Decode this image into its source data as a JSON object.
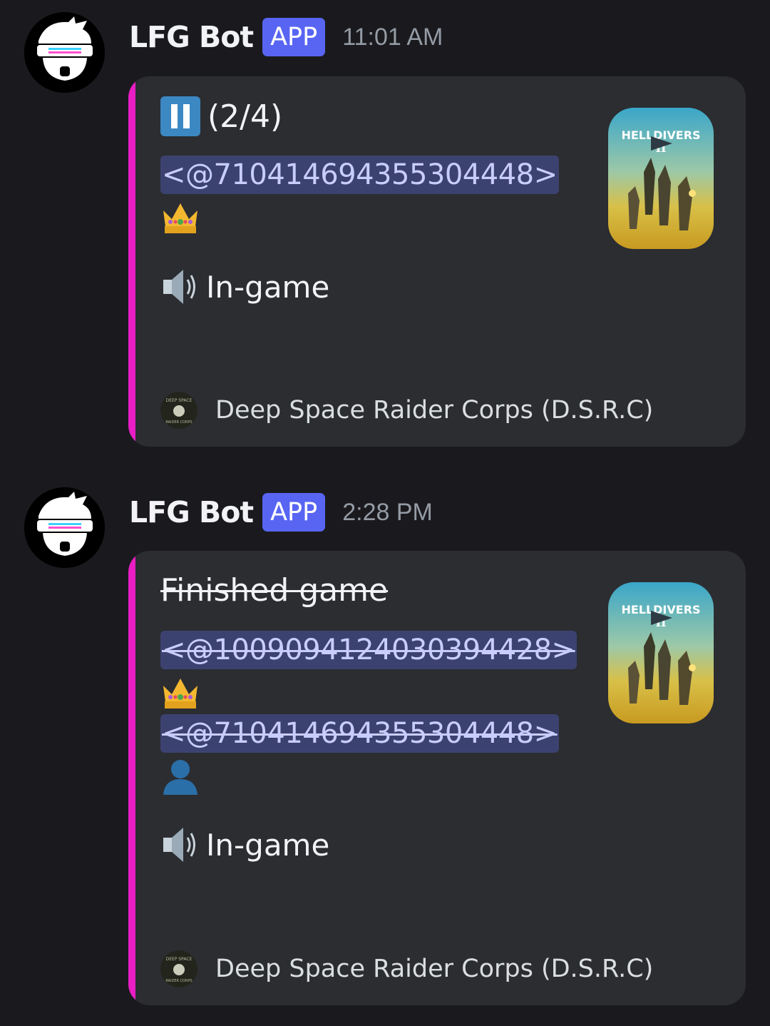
{
  "messages": [
    {
      "username": "LFG Bot",
      "badge": "APP",
      "timestamp": "11:01 AM",
      "embed": {
        "accent_color": "#e91ec4",
        "title_icon": "pause-icon",
        "title": "(2/4)",
        "mentions": [
          "<@710414694355304448>"
        ],
        "status_icon": "speaker-icon",
        "status": "In-game",
        "thumbnail_title": "HELLDIVERS",
        "thumbnail_numeral": "II",
        "footer_icon_text_top": "DEEP SPACE",
        "footer_icon_text_bottom": "RAIDER CORPS",
        "footer": "Deep Space Raider Corps (D.S.R.C)"
      }
    },
    {
      "username": "LFG Bot",
      "badge": "APP",
      "timestamp": "2:28 PM",
      "embed": {
        "accent_color": "#e91ec4",
        "title": "Finished game",
        "mentions": [
          "<@1009094124030394428>",
          "<@710414694355304448>"
        ],
        "status_icon": "speaker-icon",
        "status": "In-game",
        "thumbnail_title": "HELLDIVERS",
        "thumbnail_numeral": "II",
        "footer_icon_text_top": "DEEP SPACE",
        "footer_icon_text_bottom": "RAIDER CORPS",
        "footer": "Deep Space Raider Corps (D.S.R.C)"
      }
    }
  ]
}
